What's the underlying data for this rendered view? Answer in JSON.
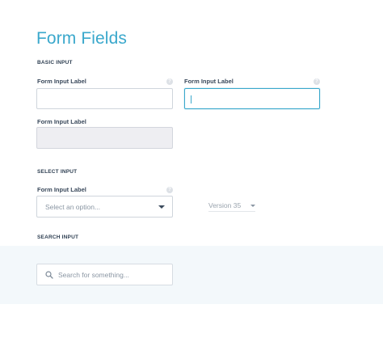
{
  "page": {
    "title": "Form Fields"
  },
  "sections": {
    "basic_input": "BASIC INPUT",
    "select_input": "SELECT INPUT",
    "search_input": "SEARCH INPUT"
  },
  "basic_fields": [
    {
      "label": "Form Input Label",
      "value": "",
      "state": "default"
    },
    {
      "label": "Form Input Label",
      "value": "",
      "state": "focused"
    },
    {
      "label": "Form Input Label",
      "value": "",
      "state": "disabled"
    }
  ],
  "select_field": {
    "label": "Form Input Label",
    "placeholder": "Select an option..."
  },
  "version_select": {
    "value": "Version 35"
  },
  "search": {
    "placeholder": "Search for something..."
  },
  "icons": {
    "help": "question-mark-icon",
    "dropdown": "chevron-down-icon",
    "search": "search-icon"
  },
  "colors": {
    "accent": "#3aa8cc",
    "text_dark": "#2e3f52",
    "border": "#cfd5dc",
    "disabled_bg": "#eeeef2",
    "search_band_bg": "#f3f8fb"
  }
}
